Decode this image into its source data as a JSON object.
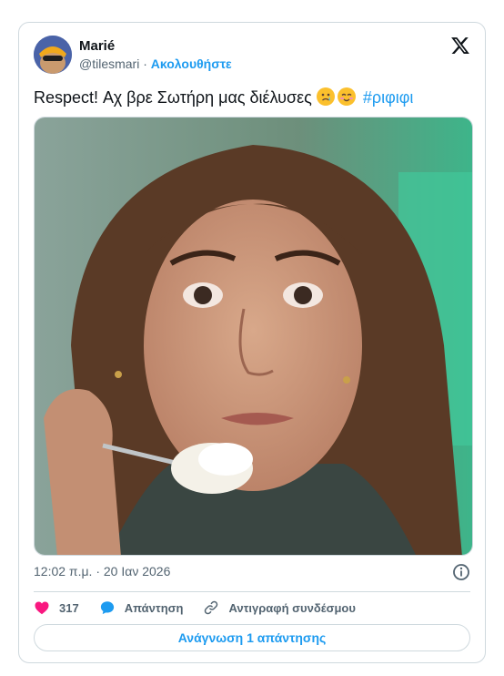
{
  "tweet": {
    "author_name": "Marié",
    "handle": "@tilesmari",
    "separator": "·",
    "follow_label": "Ακολουθήστε",
    "text": "Respect! Αχ βρε Σωτήρη μας διέλυσες",
    "hashtag": "#ριφιφι",
    "emojis": [
      "crying-face-emoji",
      "smiling-blush-emoji"
    ],
    "timestamp": "12:02 π.μ. · 20 Ιαν 2026"
  },
  "actions": {
    "like_count": "317",
    "reply_label": "Απάντηση",
    "copy_link_label": "Αντιγραφή συνδέσμου"
  },
  "read_replies_label": "Ανάγνωση 1 απάντησης",
  "colors": {
    "accent": "#1d9bf0",
    "like": "#f91880",
    "text": "#0f1419",
    "secondary": "#536471",
    "border": "#cfd9de"
  }
}
